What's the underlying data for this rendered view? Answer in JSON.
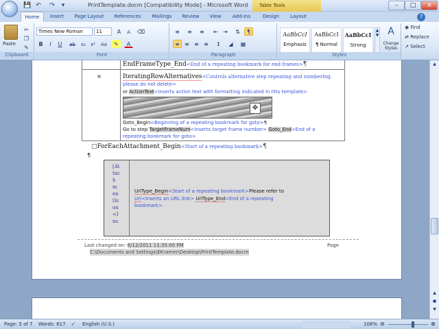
{
  "window": {
    "title": "PrintTemplate.docm [Compatibility Mode] - Microsoft Word",
    "contextual_tab": "Table Tools"
  },
  "quick_access": {
    "save_icon": "save-icon",
    "undo_icon": "undo-icon",
    "redo_icon": "redo-icon"
  },
  "tabs": [
    {
      "label": "Home"
    },
    {
      "label": "Insert"
    },
    {
      "label": "Page Layout"
    },
    {
      "label": "References"
    },
    {
      "label": "Mailings"
    },
    {
      "label": "Review"
    },
    {
      "label": "View"
    },
    {
      "label": "Add-Ins"
    },
    {
      "label": "Design"
    },
    {
      "label": "Layout"
    }
  ],
  "ribbon": {
    "clipboard": {
      "paste_label": "Paste",
      "group_label": "Clipboard"
    },
    "font": {
      "name": "Times New Roman",
      "size": "11",
      "group_label": "Font"
    },
    "paragraph": {
      "group_label": "Paragraph"
    },
    "styles": {
      "group_label": "Styles",
      "items": [
        {
          "preview": "AaBbCcI",
          "name": "Emphasis"
        },
        {
          "preview": "AaBbCcI",
          "name": "¶ Normal"
        },
        {
          "preview": "AaBbCcI",
          "name": "Strong"
        }
      ],
      "change_styles_label": "Change Styles"
    },
    "editing": {
      "find": "Find",
      "replace": "Replace",
      "select": "Select"
    }
  },
  "document": {
    "row1": {
      "field": "EndFrameType_End",
      "desc": "<End of a repeating bookmark for end frames>"
    },
    "row2": {
      "line1_field": "IteratingRowAlternatives",
      "line1_desc": "<Controls alternative step repeating and numbering,",
      "line1b": "please do not delete>",
      "line2_prefix": "or",
      "line2_field": "ActionText",
      "line2_desc": "<Inserts action text with formatting indicated in this template>",
      "goto_begin": "Goto_Begin",
      "goto_begin_desc": "<Beginning of a repeating bookmark for goto>",
      "goto_step_prefix": "Go to step",
      "target_field": "TargetFrameNum",
      "target_desc": "<Inserts target frame number>",
      "goto_end": "Goto_End",
      "goto_end_desc": "<End of a",
      "goto_end_desc2": "repeating bookmark for goto>"
    },
    "foreach": {
      "field": "ForEachAttachment_Begin",
      "desc": "<Start of a repeating bookmark>"
    },
    "attachment": {
      "vertical": [
        "[At",
        "tac",
        "h",
        "m",
        "en",
        "tIc",
        "on",
        "<I",
        "ns"
      ],
      "urltype_begin": "UrlType_Begin",
      "urltype_begin_desc": "<Start of a repeating bookmark>",
      "please_refer": "Please refer to",
      "url_field": "Url",
      "url_desc": "<Inserts an URL link>",
      "urltype_end": "UrlType_End",
      "urltype_end_desc": "<End of a repeating",
      "urltype_end_desc2": "bookmark>"
    },
    "footer": {
      "last_changed_label": "Last changed on:",
      "last_changed_value": "6/12/2011 11:35:00 PM",
      "page_label": "Page",
      "path": "C:\\Documents and Settings\\EKramer\\Desktop\\PrintTemplate.docm"
    }
  },
  "status": {
    "page": "Page: 5 of 7",
    "words": "Words: 617",
    "language": "English (U.S.)",
    "zoom": "108%"
  }
}
